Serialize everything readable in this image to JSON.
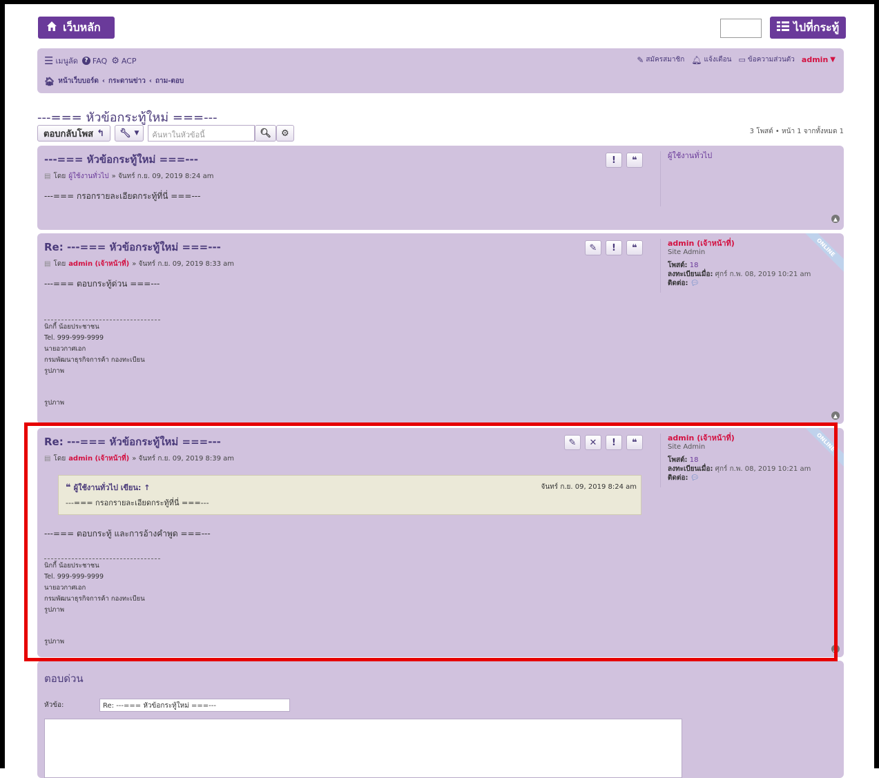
{
  "header": {
    "home_button": "เว็บหลัก",
    "jump_button": "ไปที่กระทู้"
  },
  "nav": {
    "menu": "เมนูลัด",
    "faq": "FAQ",
    "acp": "ACP",
    "register": "สมัครสมาชิก",
    "notifications": "แจ้งเตือน",
    "messages": "ข้อความส่วนตัว",
    "user": "admin"
  },
  "breadcrumb": [
    "หน้าเว็บบอร์ด",
    "กระดานข่าว",
    "ถาม-ตอบ"
  ],
  "topic": {
    "title": "---=== หัวข้อกระทู้ใหม่ ===---",
    "reply_button": "ตอบกลับโพส",
    "search_placeholder": "ค้นหาในหัวข้อนี้",
    "pagination": "3 โพสต์ • หน้า 1 จากทั้งหมด 1"
  },
  "posts": [
    {
      "title": "---=== หัวข้อกระทู้ใหม่ ===---",
      "by": "โดย",
      "author": "ผู้ใช้งานทั่วไป",
      "date": "» จันทร์ ก.ย. 09, 2019 8:24 am",
      "content": "---=== กรอกรายละเอียดกระทู้ที่นี่ ===---",
      "profile_name": "ผู้ใช้งานทั่วไป"
    },
    {
      "title": "Re: ---=== หัวข้อกระทู้ใหม่ ===---",
      "by": "โดย",
      "author": "admin (เจ้าหน้าที่)",
      "date": "» จันทร์ ก.ย. 09, 2019 8:33 am",
      "content": "---=== ตอบกระทู้ด่วน ===---",
      "sig": [
        "นิกกี้ น้อยประชาชน",
        "Tel. 999-999-9999",
        "นายอวกาศเอก",
        "กรมพัฒนาธุรกิจการค้า กองทะเบียน",
        "รูปภาพ"
      ],
      "sig_image": "รูปภาพ",
      "profile_name": "admin (เจ้าหน้าที่)",
      "rank": "Site Admin",
      "posts_label": "โพสต์:",
      "posts_count": "18",
      "joined_label": "ลงทะเบียนเมื่อ:",
      "joined": "ศุกร์ ก.พ. 08, 2019 10:21 am",
      "contact_label": "ติดต่อ:",
      "online": "ONLINE"
    },
    {
      "title": "Re: ---=== หัวข้อกระทู้ใหม่ ===---",
      "by": "โดย",
      "author": "admin (เจ้าหน้าที่)",
      "date": "» จันทร์ ก.ย. 09, 2019 8:39 am",
      "quote_author": "ผู้ใช้งานทั่วไป เขียน: ↑",
      "quote_date": "จันทร์ ก.ย. 09, 2019 8:24 am",
      "quote_text": "---=== กรอกรายละเอียดกระทู้ที่นี่ ===---",
      "content": "---=== ตอบกระทู้ และการอ้างคำพูด ===---",
      "sig": [
        "นิกกี้ น้อยประชาชน",
        "Tel. 999-999-9999",
        "นายอวกาศเอก",
        "กรมพัฒนาธุรกิจการค้า กองทะเบียน",
        "รูปภาพ"
      ],
      "sig_image": "รูปภาพ",
      "profile_name": "admin (เจ้าหน้าที่)",
      "rank": "Site Admin",
      "posts_label": "โพสต์:",
      "posts_count": "18",
      "joined_label": "ลงทะเบียนเมื่อ:",
      "joined": "ศุกร์ ก.พ. 08, 2019 10:21 am",
      "contact_label": "ติดต่อ:",
      "online": "ONLINE"
    }
  ],
  "quick_reply": {
    "title": "ตอบด่วน",
    "subject_label": "หัวข้อ:",
    "subject_value": "Re: ---=== หัวข้อกระทู้ใหม่ ===---"
  },
  "colors": {
    "accent": "#6a3a9a",
    "panel": "#d1c2de",
    "highlight": "#e60000",
    "admin": "#d31141"
  }
}
